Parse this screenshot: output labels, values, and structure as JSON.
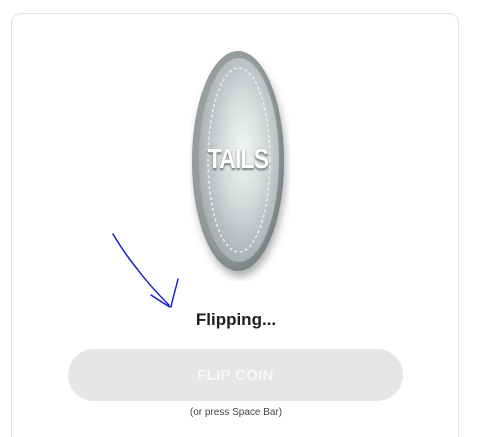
{
  "coin": {
    "face_label": "TAILS",
    "icon": "coin-icon",
    "colors": {
      "rim": "#8c9495",
      "face_light": "#f1f3f3",
      "face_dark": "#a3abac",
      "dashed_ring": "#e9eded"
    }
  },
  "status": {
    "text": "Flipping..."
  },
  "flip_button": {
    "label": "FLIP COIN",
    "state": "disabled",
    "background": "#e6e6e6"
  },
  "hint": {
    "text": "(or press Space Bar)"
  },
  "annotation": {
    "icon": "hand-drawn-arrow-icon",
    "color": "#1010c8"
  }
}
